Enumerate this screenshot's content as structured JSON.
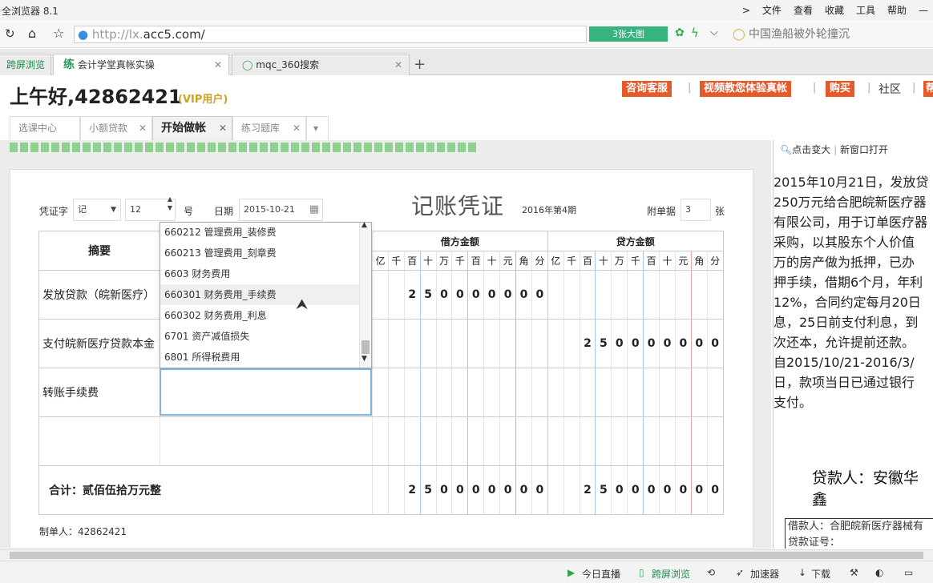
{
  "browser": {
    "title": "全浏览器 8.1",
    "menu": [
      "文件",
      "查看",
      "收藏",
      "工具",
      "帮助"
    ],
    "url_prefix": "http://lx.",
    "url_domain": "acc5.com/",
    "big_image": "3张大图",
    "search_text": "中国渔船被外轮撞沉"
  },
  "tabs": [
    {
      "label": "跨屏浏览"
    },
    {
      "label": "会计学堂真帐实操"
    },
    {
      "label": "mqc_360搜索"
    }
  ],
  "header": {
    "greeting": "上午好,42862421",
    "vip": "(VIP用户)",
    "buttons": [
      "咨询客服",
      "视频教您体验真帐",
      "购买"
    ],
    "community": "社区",
    "cut": "帮"
  },
  "subtabs": [
    "选课中心",
    "小额贷款",
    "开始做帐",
    "练习题库"
  ],
  "voucher": {
    "title": "记账凭证",
    "period": "2016年第4期",
    "voucher_label": "凭证字",
    "voucher_word": "记",
    "number": "12",
    "number_suffix": "号",
    "date_label": "日期",
    "date": "2015-10-21",
    "attach_label": "附单据",
    "attach_count": "3",
    "attach_suffix": "张",
    "preparer": "制单人：42862421",
    "col_summary": "摘要",
    "col_debit": "借方金额",
    "col_credit": "贷方金额",
    "units": [
      "亿",
      "千",
      "百",
      "十",
      "万",
      "千",
      "百",
      "十",
      "元",
      "角",
      "分"
    ],
    "rows": [
      {
        "summary": "发放贷款（皖新医疗）",
        "debit": [
          "",
          "",
          "2",
          "5",
          "0",
          "0",
          "0",
          "0",
          "0",
          "0",
          "0"
        ],
        "credit": [
          "",
          "",
          "",
          "",
          "",
          "",
          "",
          "",
          "",
          "",
          ""
        ]
      },
      {
        "summary": "支付皖新医疗贷款本金",
        "debit": [
          "",
          "",
          "",
          "",
          "",
          "",
          "",
          "",
          "",
          "",
          ""
        ],
        "credit": [
          "",
          "",
          "2",
          "5",
          "0",
          "0",
          "0",
          "0",
          "0",
          "0",
          "0"
        ]
      },
      {
        "summary": "转账手续费",
        "debit": [
          "",
          "",
          "",
          "",
          "",
          "",
          "",
          "",
          "",
          "",
          ""
        ],
        "credit": [
          "",
          "",
          "",
          "",
          "",
          "",
          "",
          "",
          "",
          "",
          ""
        ]
      },
      {
        "summary": "",
        "debit": [
          "",
          "",
          "",
          "",
          "",
          "",
          "",
          "",
          "",
          "",
          ""
        ],
        "credit": [
          "",
          "",
          "",
          "",
          "",
          "",
          "",
          "",
          "",
          "",
          ""
        ]
      }
    ],
    "total_label": "合计：贰佰伍拾万元整",
    "total_debit": [
      "",
      "",
      "2",
      "5",
      "0",
      "0",
      "0",
      "0",
      "0",
      "0",
      "0"
    ],
    "total_credit": [
      "",
      "",
      "2",
      "5",
      "0",
      "0",
      "0",
      "0",
      "0",
      "0",
      "0"
    ]
  },
  "dropdown": [
    "660212 管理费用_装修费",
    "660213 管理费用_刻章费",
    "6603 财务费用",
    "660301 财务费用_手续费",
    "660302 财务费用_利息",
    "6701 资产减值损失",
    "6801 所得税费用"
  ],
  "right_panel": {
    "zoom": "点击变大",
    "open": "新窗口打开",
    "lines": [
      "2015年10月21日，发放贷",
      "250万元给合肥皖新医疗器",
      "有限公司，用于订单医疗器",
      "采购，以其股东个人价值",
      "万的房产做为抵押，已办",
      "押手续，借期6个月，年利",
      "12%，合同约定每月20日",
      "息，25日前支付利息，到",
      "次还本，允许提前还款。",
      "自2015/10/21-2016/3/",
      "日，款项当日已通过银行",
      "支付。"
    ],
    "lender": "贷款人：安徽华鑫",
    "borrower": "借款人：合肥皖新医疗器械有",
    "loan_no": "贷款证号："
  },
  "status": {
    "live": "今日直播",
    "cross": "跨屏浏览",
    "speed": "加速器",
    "download": "下载"
  }
}
